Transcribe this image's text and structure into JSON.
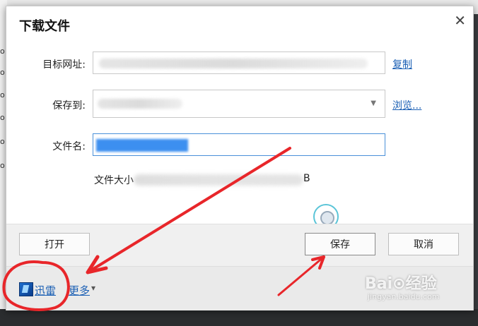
{
  "dialog": {
    "title": "下载文件",
    "close_glyph": "✕"
  },
  "form": {
    "url_label": "目标网址:",
    "copy_link": "复制",
    "save_label": "保存到:",
    "browse_link": "浏览...",
    "filename_label": "文件名:",
    "filesize_label": "文件大小",
    "filesize_suffix": "B"
  },
  "buttons": {
    "open": "打开",
    "save": "保存",
    "cancel": "取消"
  },
  "bottom": {
    "xunlei": "迅雷",
    "more": "更多",
    "more_arrow": "▾"
  },
  "watermark": {
    "brand": "Bai⊙经验",
    "url": "jingyan.baidu.com"
  },
  "colors": {
    "link": "#1a5fb4",
    "annotation": "#e8262a",
    "selection": "#3c8ff0"
  }
}
